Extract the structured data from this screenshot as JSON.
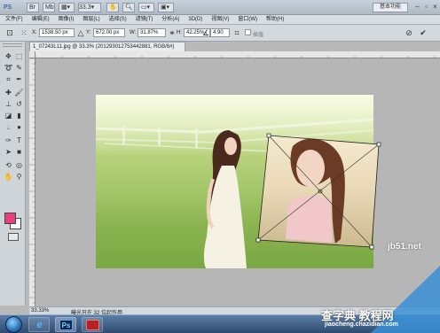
{
  "titlebar": {
    "logo": "PS",
    "zoom_value": "33.3",
    "workspace": "基本功能",
    "minimize": "–",
    "restore": "▫",
    "close": "×"
  },
  "menu": [
    "文件(F)",
    "编辑(E)",
    "图像(I)",
    "图层(L)",
    "选择(S)",
    "滤镜(T)",
    "分析(A)",
    "3D(D)",
    "视图(V)",
    "窗口(W)",
    "帮助(H)"
  ],
  "options": {
    "x_label": "X:",
    "x_value": "1538.50 px",
    "y_label": "Y:",
    "y_value": "672.00 px",
    "w_label": "W:",
    "w_value": "31.87%",
    "h_label": "H:",
    "h_value": "42.25%",
    "angle_value": "4.90",
    "interp_label": "插值"
  },
  "document": {
    "tab_title": "1_07243L11.jpg @ 33.3% (201293012753442881, RGB/8#)",
    "tab_close": "×"
  },
  "colors": {
    "foreground": "#e83f7d",
    "background": "#ffffff"
  },
  "status": {
    "zoom": "33.33%",
    "info": "曝光只在 32 位起作用"
  },
  "taskbar": {
    "ps_label": "Ps",
    "ie_label": "e"
  },
  "watermark": {
    "site1": "jb51.net",
    "site2": "查字典 教程网",
    "site3": "jiaocheng.chazidian.com"
  }
}
